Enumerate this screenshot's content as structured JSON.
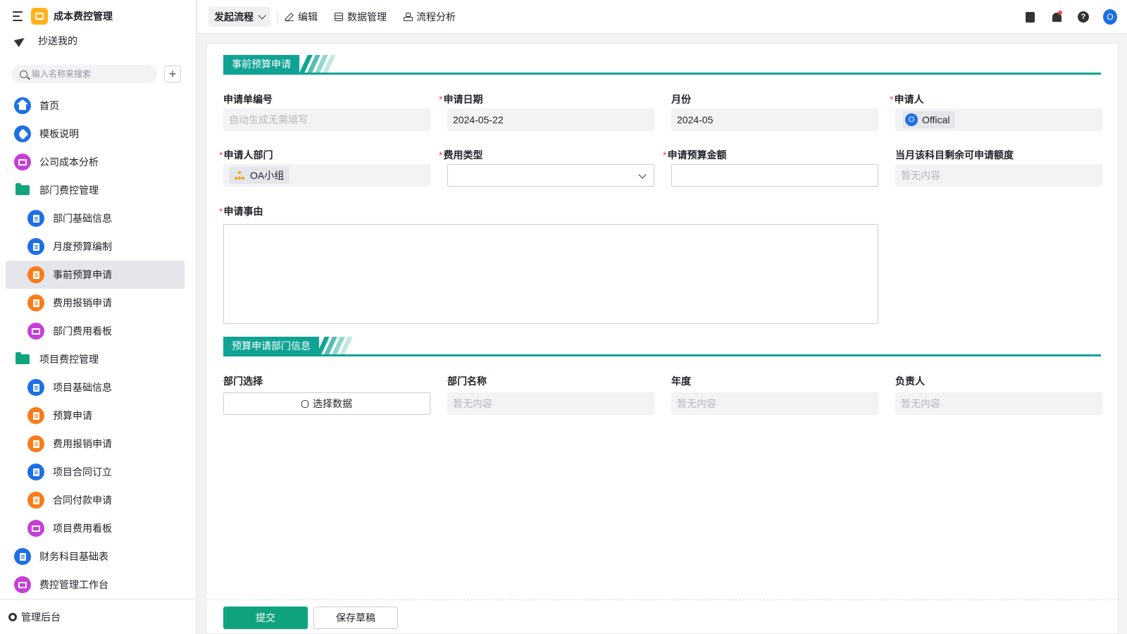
{
  "app": {
    "title": "成本费控管理"
  },
  "sidebar": {
    "cc_label": "抄送我的",
    "search_placeholder": "输入名称来搜索",
    "add_label": "+",
    "items": [
      {
        "label": "首页",
        "icon": "home-icon",
        "color": "#1e6fe6",
        "indent": false,
        "active": false
      },
      {
        "label": "模板说明",
        "icon": "tag-icon",
        "color": "#1e6fe6",
        "indent": false,
        "active": false
      },
      {
        "label": "公司成本分析",
        "icon": "dashboard-icon",
        "color": "#c53fd6",
        "indent": false,
        "active": false
      },
      {
        "label": "部门费控管理",
        "icon": "folder-icon",
        "color": "#10a37f",
        "indent": false,
        "active": false
      },
      {
        "label": "部门基础信息",
        "icon": "form-icon",
        "color": "#1e6fe6",
        "indent": true,
        "active": false
      },
      {
        "label": "月度预算编制",
        "icon": "form-icon",
        "color": "#1e6fe6",
        "indent": true,
        "active": false
      },
      {
        "label": "事前预算申请",
        "icon": "flow-form-icon",
        "color": "#f97c1a",
        "indent": true,
        "active": true
      },
      {
        "label": "费用报销申请",
        "icon": "flow-form-icon",
        "color": "#f97c1a",
        "indent": true,
        "active": false
      },
      {
        "label": "部门费用看板",
        "icon": "dashboard-icon",
        "color": "#c53fd6",
        "indent": true,
        "active": false
      },
      {
        "label": "项目费控管理",
        "icon": "folder-icon",
        "color": "#10a37f",
        "indent": false,
        "active": false
      },
      {
        "label": "项目基础信息",
        "icon": "form-icon",
        "color": "#1e6fe6",
        "indent": true,
        "active": false
      },
      {
        "label": "预算申请",
        "icon": "flow-form-icon",
        "color": "#f97c1a",
        "indent": true,
        "active": false
      },
      {
        "label": "费用报销申请",
        "icon": "flow-form-icon",
        "color": "#f97c1a",
        "indent": true,
        "active": false
      },
      {
        "label": "项目合同订立",
        "icon": "form-icon",
        "color": "#1e6fe6",
        "indent": true,
        "active": false
      },
      {
        "label": "合同付款申请",
        "icon": "flow-form-icon",
        "color": "#f97c1a",
        "indent": true,
        "active": false
      },
      {
        "label": "项目费用看板",
        "icon": "dashboard-icon",
        "color": "#c53fd6",
        "indent": true,
        "active": false
      },
      {
        "label": "财务科目基础表",
        "icon": "form-icon",
        "color": "#1e6fe6",
        "indent": false,
        "active": false
      },
      {
        "label": "费控管理工作台",
        "icon": "dashboard-icon",
        "color": "#c53fd6",
        "indent": false,
        "active": false
      }
    ],
    "admin_label": "管理后台"
  },
  "toolbar": {
    "launch_label": "发起流程",
    "edit_label": "编辑",
    "data_label": "数据管理",
    "analysis_label": "流程分析",
    "avatar_letter": "O"
  },
  "form": {
    "section1_title": "事前预算申请",
    "section2_title": "预算申请部门信息",
    "fields": {
      "apply_no": {
        "label": "申请单编号",
        "required": false,
        "placeholder": "自动生成无需填写"
      },
      "apply_date": {
        "label": "申请日期",
        "required": true,
        "value": "2024-05-22"
      },
      "month": {
        "label": "月份",
        "required": false,
        "value": "2024-05"
      },
      "applicant": {
        "label": "申请人",
        "required": true,
        "avatar_letter": "O",
        "value": "Offical"
      },
      "dept": {
        "label": "申请人部门",
        "required": true,
        "value": "OA小组"
      },
      "expense_type": {
        "label": "费用类型",
        "required": true,
        "value": ""
      },
      "amount": {
        "label": "申请预算金额",
        "required": true,
        "value": ""
      },
      "remaining": {
        "label": "当月该科目剩余可申请额度",
        "required": false,
        "placeholder": "暂无内容"
      },
      "reason": {
        "label": "申请事由",
        "required": true,
        "value": ""
      },
      "dept_select": {
        "label": "部门选择",
        "button": "选择数据"
      },
      "dept_name": {
        "label": "部门名称",
        "placeholder": "暂无内容"
      },
      "year": {
        "label": "年度",
        "placeholder": "暂无内容"
      },
      "owner": {
        "label": "负责人",
        "placeholder": "暂无内容"
      }
    },
    "submit_label": "提交",
    "draft_label": "保存草稿"
  },
  "colors": {
    "accent": "#10a394",
    "primary_button": "#10a37f",
    "required": "#f54a45",
    "link_blue": "#1e6fe6"
  }
}
